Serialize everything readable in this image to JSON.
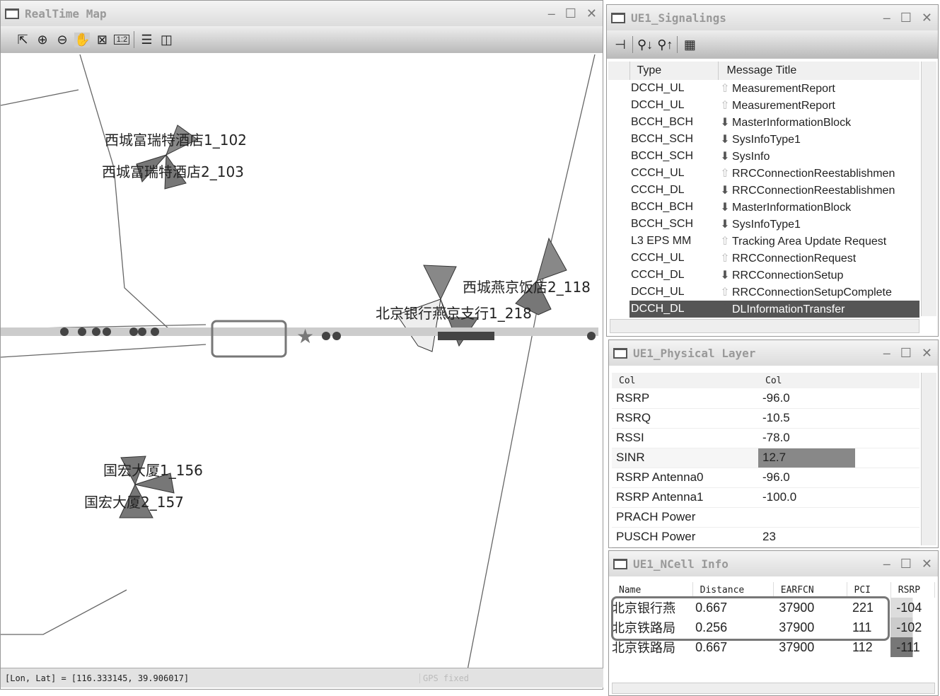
{
  "map_window": {
    "title": "RealTime Map",
    "toolbar": [
      "select-icon",
      "zoom-in-icon",
      "zoom-out-icon",
      "pan-hand-icon",
      "fit-extent-icon",
      "scale-icon",
      "layers-icon",
      "panel-icon"
    ],
    "sites": [
      {
        "label": "西城富瑞特酒店1_102"
      },
      {
        "label": "西城富瑞特酒店2_103"
      },
      {
        "label": "西城燕京饭店2_118"
      },
      {
        "label": "北京银行燕京支行1_218"
      },
      {
        "label": "国宏大厦1_156"
      },
      {
        "label": "国宏大厦2_157"
      }
    ],
    "status": "[Lon, Lat] = [116.333145, 39.906017]",
    "gps": "GPS fixed"
  },
  "signalings": {
    "title": "UE1_Signalings",
    "columns": [
      "Type",
      "Message Title"
    ],
    "rows": [
      {
        "type": "DCCH_UL",
        "dir": "up",
        "title": "MeasurementReport"
      },
      {
        "type": "DCCH_UL",
        "dir": "up",
        "title": "MeasurementReport"
      },
      {
        "type": "BCCH_BCH",
        "dir": "down",
        "title": "MasterInformationBlock"
      },
      {
        "type": "BCCH_SCH",
        "dir": "down",
        "title": "SysInfoType1"
      },
      {
        "type": "BCCH_SCH",
        "dir": "down",
        "title": "SysInfo"
      },
      {
        "type": "CCCH_UL",
        "dir": "up",
        "title": "RRCConnectionReestablishmen"
      },
      {
        "type": "CCCH_DL",
        "dir": "down",
        "title": "RRCConnectionReestablishmen"
      },
      {
        "type": "BCCH_BCH",
        "dir": "down",
        "title": "MasterInformationBlock"
      },
      {
        "type": "BCCH_SCH",
        "dir": "down",
        "title": "SysInfoType1"
      },
      {
        "type": "L3 EPS MM",
        "dir": "up",
        "title": "Tracking Area Update Request"
      },
      {
        "type": "CCCH_UL",
        "dir": "up",
        "title": "RRCConnectionRequest"
      },
      {
        "type": "CCCH_DL",
        "dir": "down",
        "title": "RRCConnectionSetup"
      },
      {
        "type": "DCCH_UL",
        "dir": "up",
        "title": "RRCConnectionSetupComplete"
      },
      {
        "type": "DCCH_DL",
        "dir": "down",
        "title": "DLInformationTransfer",
        "selected": true
      }
    ]
  },
  "physical": {
    "title": "UE1_Physical Layer",
    "columns": [
      "Col",
      "Col"
    ],
    "rows": [
      {
        "k": "RSRP",
        "v": "-96.0"
      },
      {
        "k": "RSRQ",
        "v": "-10.5"
      },
      {
        "k": "RSSI",
        "v": "-78.0"
      },
      {
        "k": "SINR",
        "v": "12.7",
        "bar": 0.6
      },
      {
        "k": "RSRP Antenna0",
        "v": "-96.0"
      },
      {
        "k": "RSRP Antenna1",
        "v": "-100.0"
      },
      {
        "k": "PRACH Power",
        "v": ""
      },
      {
        "k": "PUSCH Power",
        "v": "23"
      }
    ]
  },
  "ncell": {
    "title": "UE1_NCell Info",
    "columns": [
      "Name",
      "Distance",
      "EARFCN",
      "PCI",
      "RSRP"
    ],
    "rows": [
      {
        "name": "北京银行燕",
        "dist": "0.667",
        "earfcn": "37900",
        "pci": "221",
        "rsrp": "-104"
      },
      {
        "name": "北京铁路局",
        "dist": "0.256",
        "earfcn": "37900",
        "pci": "111",
        "rsrp": "-102"
      },
      {
        "name": "北京铁路局",
        "dist": "0.667",
        "earfcn": "37900",
        "pci": "112",
        "rsrp": "-111"
      }
    ]
  }
}
